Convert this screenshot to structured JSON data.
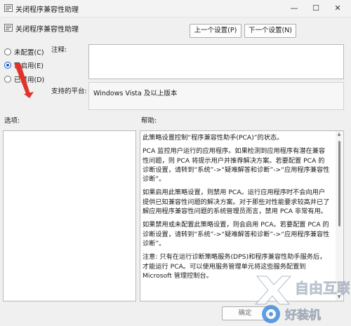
{
  "window": {
    "title": "关闭程序兼容性助理",
    "minimize_icon": "minimize-icon",
    "maximize_icon": "maximize-icon",
    "close_icon": "close-icon"
  },
  "header": {
    "policy_name": "关闭程序兼容性助理",
    "prev_label": "上一个设置(P)",
    "next_label": "下一个设置(N)"
  },
  "options": {
    "not_configured": "未配置(C)",
    "enabled": "已启用(E)",
    "disabled": "已禁用(D)",
    "selected": "enabled"
  },
  "comment": {
    "label": "注释:",
    "value": ""
  },
  "platform": {
    "label": "支持的平台:",
    "value": "Windows Vista 及以上版本"
  },
  "sections": {
    "options_label": "选项:",
    "help_label": "帮助:"
  },
  "help": {
    "paragraphs": [
      "此策略设置控制“程序兼容性助手(PCA)”的状态。",
      "PCA 监控用户运行的应用程序。如果检测到应用程序有潜在兼容性问题，则 PCA 将提示用户并推荐解决方案。若要配置 PCA 的诊断设置，请转到“系统”->“疑难解答和诊断”->“应用程序兼容性诊断”。",
      "如果启用此策略设置，则禁用 PCA。运行应用程序时不会向用户提供已知兼容性问题的解决方案。对于那些对性能要求较高并已了解应用程序兼容性问题的系统管理员而言，禁用 PCA 非常有用。",
      "如果禁用或未配置此策略设置，则会启用 PCA。若要配置 PCA 的诊断设置，请转到“系统”->“疑难解答和诊断”->“应用程序兼容性诊断”。",
      "注意: 只有在运行诊断策略服务(DPS)和程序兼容性助手服务后，才能运行 PCA。可以使用服务管理单元将这些服务配置到 Microsoft 管理控制台。"
    ],
    "note_prefix": "注意:"
  },
  "footer": {
    "ok_label": "确定"
  },
  "watermark": {
    "brand": "自由互联",
    "sub": "好装机"
  },
  "colors": {
    "accent": "#1a56c9",
    "pointer": "#e0342b"
  }
}
